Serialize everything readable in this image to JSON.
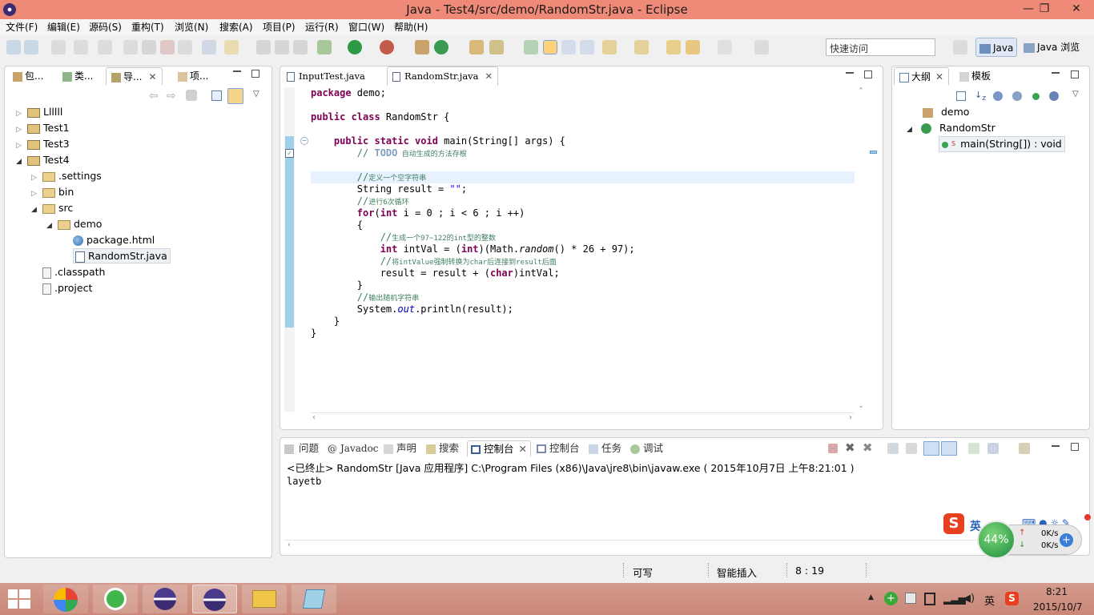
{
  "window": {
    "title": "Java  -  Test4/src/demo/RandomStr.java  -  Eclipse",
    "min": "—",
    "restore": "❐",
    "close": "✕"
  },
  "menu": [
    "文件(F)",
    "编辑(E)",
    "源码(S)",
    "重构(T)",
    "浏览(N)",
    "搜索(A)",
    "项目(P)",
    "运行(R)",
    "窗口(W)",
    "帮助(H)"
  ],
  "quick_access": {
    "placeholder": "快速访问"
  },
  "perspectives": [
    "Java",
    "Java 浏览"
  ],
  "left_panel": {
    "tabs": [
      "包...",
      "类...",
      "导...",
      "项..."
    ],
    "tree": [
      {
        "label": "Llllll",
        "arrow": "▷",
        "icon": "project"
      },
      {
        "label": "Test1",
        "arrow": "▷",
        "icon": "project"
      },
      {
        "label": "Test3",
        "arrow": "▷",
        "icon": "project"
      },
      {
        "label": "Test4",
        "arrow": "◢",
        "icon": "project"
      },
      {
        "label": ".settings",
        "arrow": "▷",
        "icon": "folder"
      },
      {
        "label": "bin",
        "arrow": "▷",
        "icon": "folder"
      },
      {
        "label": "src",
        "arrow": "◢",
        "icon": "folder"
      },
      {
        "label": "demo",
        "arrow": "◢",
        "icon": "folder"
      },
      {
        "label": "package.html",
        "arrow": "",
        "icon": "html"
      },
      {
        "label": "RandomStr.java",
        "arrow": "",
        "icon": "java"
      },
      {
        "label": ".classpath",
        "arrow": "",
        "icon": "file"
      },
      {
        "label": ".project",
        "arrow": "",
        "icon": "file"
      }
    ]
  },
  "editor": {
    "tabs": [
      "InputTest.java",
      "RandomStr.java"
    ],
    "lines": {
      "l1a": "package",
      "l1b": " demo;",
      "l2a": "public class",
      "l2b": " RandomStr {",
      "l3a": "    public static void",
      "l3b": " main(String[] args) {",
      "l4a": "        // ",
      "l4b": "TODO",
      "l4c": " 自动生成的方法存根",
      "l5a": "        //",
      "l5b": "定义一个空字符串",
      "l6a": "        String result = ",
      "l6b": "\"\"",
      "l6c": ";",
      "l7a": "        //",
      "l7b": "进行6次循环",
      "l8a": "        for",
      "l8b": "(",
      "l8c": "int",
      "l8d": " i = 0 ; i < 6 ; i ++)",
      "l9": "        {",
      "l10a": "            //",
      "l10b": "生成一个97~122的int型的整数",
      "l11a": "            int",
      "l11b": " intVal = (",
      "l11c": "int",
      "l11d": ")(Math.",
      "l11e": "random",
      "l11f": "() * 26 + 97);",
      "l12a": "            //",
      "l12b": "将intValue强制转换为char后连接到result后面",
      "l13a": "            result = result + (",
      "l13b": "char",
      "l13c": ")intVal;",
      "l14": "        }",
      "l15a": "        //",
      "l15b": "输出随机字符串",
      "l16a": "        System.",
      "l16b": "out",
      "l16c": ".println(result);",
      "l17": "    }",
      "l18": "}"
    }
  },
  "outline": {
    "tabs": [
      "大纲",
      "模板"
    ],
    "items": [
      "demo",
      "RandomStr",
      "main(String[]) : void"
    ]
  },
  "console": {
    "tabs": [
      "问题",
      "Javadoc",
      "声明",
      "搜索",
      "控制台",
      "控制台",
      "任务",
      "调试"
    ],
    "header": "<已终止> RandomStr [Java 应用程序] C:\\Program Files (x86)\\Java\\jre8\\bin\\javaw.exe ( 2015年10月7日 上午8:21:01 )",
    "output": "layetb"
  },
  "status": {
    "writable": "可写",
    "insert": "智能插入",
    "position": "8 : 19"
  },
  "widget": {
    "percent": "44%",
    "up": "0K/s",
    "down": "0K/s",
    "ime": "英"
  },
  "taskbar": {
    "time": "8:21",
    "date": "2015/10/7",
    "ime": "英"
  },
  "colors": {
    "titlebar": "#f08a78",
    "keyword": "#7f0055",
    "comment": "#3f7f5f",
    "string": "#2a00ff",
    "taskbar": "#c98777"
  }
}
